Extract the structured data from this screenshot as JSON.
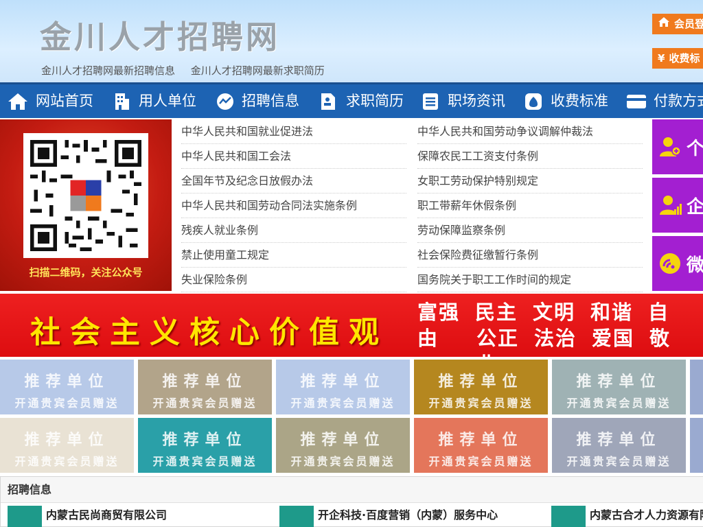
{
  "header": {
    "site_title": "金川人才招聘网",
    "sub_links": [
      "金川人才招聘网最新招聘信息",
      "金川人才招聘网最新求职简历"
    ],
    "member_login": "会员登",
    "fee": "收费标",
    "fee_symbol": "¥"
  },
  "nav": {
    "items": [
      "网站首页",
      "用人单位",
      "招聘信息",
      "求职简历",
      "职场资讯",
      "收费标准",
      "付款方式"
    ]
  },
  "qr": {
    "caption": "扫描二维码，关注公众号"
  },
  "laws": {
    "left": [
      "中华人民共和国就业促进法",
      "中华人民共和国工会法",
      "全国年节及纪念日放假办法",
      "中华人民共和国劳动合同法实施条例",
      "残疾人就业条例",
      "禁止使用童工规定",
      "失业保险条例"
    ],
    "right": [
      "中华人民共和国劳动争议调解仲裁法",
      "保障农民工工资支付条例",
      "女职工劳动保护特别规定",
      "职工带薪年休假条例",
      "劳动保障监察条例",
      "社会保险费征缴暂行条例",
      "国务院关于职工工作时间的规定"
    ]
  },
  "side": {
    "items": [
      "个",
      "企",
      "微"
    ]
  },
  "banner": {
    "main": "社会主义核心价值观",
    "row1": [
      "富强",
      "民主",
      "文明",
      "和谐",
      "自由"
    ],
    "row2": [
      "公正",
      "法治",
      "爱国",
      "敬业"
    ]
  },
  "promo": {
    "title": "推荐单位",
    "subtitle": "开通贵宾会员赠送",
    "colors_row1": [
      "#b7c9e8",
      "#b2a48a",
      "#b7c9e8",
      "#b5871f",
      "#9fb2b4",
      "#9aaad0"
    ],
    "colors_row2": [
      "#e9e2d4",
      "#2aa0a8",
      "#aba587",
      "#e4765b",
      "#9fa6b9",
      "#9aaad0"
    ]
  },
  "jobs": {
    "heading": "招聘信息",
    "items": [
      "内蒙古民尚商贸有限公司",
      "开企科技·百度营销（内蒙）服务中心",
      "内蒙古合才人力资源有限"
    ]
  }
}
